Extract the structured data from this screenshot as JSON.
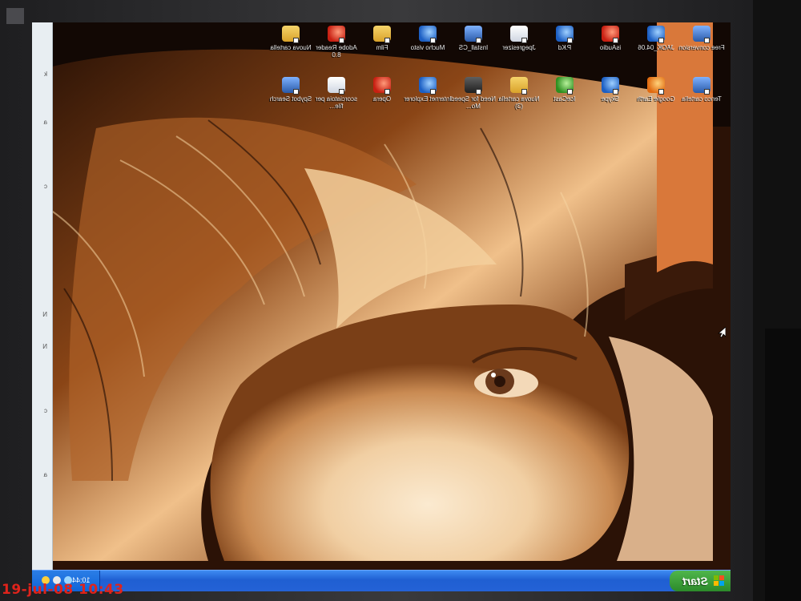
{
  "taskbar": {
    "start_label": "Start",
    "clock": "10:44"
  },
  "desktop_icons": [
    {
      "label": "Free conversion",
      "icon": "download-app-icon",
      "style": "g-app"
    },
    {
      "label": "JAOK_04.06",
      "icon": "globe-icon",
      "style": "g-blue"
    },
    {
      "label": "isAudio",
      "icon": "music-app-icon",
      "style": "g-red"
    },
    {
      "label": "P.Kd",
      "icon": "recycle-bin-icon",
      "style": "g-blue"
    },
    {
      "label": "Jpegresizer",
      "icon": "image-app-icon",
      "style": "g-paper"
    },
    {
      "label": "Install_CS",
      "icon": "installer-icon",
      "style": "g-app"
    },
    {
      "label": "Mucho visto",
      "icon": "network-icon",
      "style": "g-blue"
    },
    {
      "label": "Film",
      "icon": "folder-icon",
      "style": "g-folder"
    },
    {
      "label": "Adobe Reader 8.0",
      "icon": "acrobat-icon",
      "style": "g-red"
    },
    {
      "label": "Nuova cartella",
      "icon": "folder-icon",
      "style": "g-folder"
    },
    {
      "label": "Tenco cartella",
      "icon": "computer-icon",
      "style": "g-app"
    },
    {
      "label": "Google Earth",
      "icon": "earth-icon",
      "style": "g-orange"
    },
    {
      "label": "Skype",
      "icon": "skype-icon",
      "style": "g-blue"
    },
    {
      "label": "IceCast",
      "icon": "media-icon",
      "style": "g-green"
    },
    {
      "label": "Nuova cartella (3)",
      "icon": "folder-icon",
      "style": "g-folder"
    },
    {
      "label": "Need for Speed Mo...",
      "icon": "game-icon",
      "style": "g-dark"
    },
    {
      "label": "Internet Explorer",
      "icon": "internet-explorer-icon",
      "style": "g-blue"
    },
    {
      "label": "Opera",
      "icon": "opera-icon",
      "style": "g-red"
    },
    {
      "label": "scorciatoia per file...",
      "icon": "document-icon",
      "style": "g-paper"
    },
    {
      "label": "Spybot Search",
      "icon": "spybot-icon",
      "style": "g-app"
    }
  ],
  "camera_timestamp": "19-jul-08 10:43"
}
